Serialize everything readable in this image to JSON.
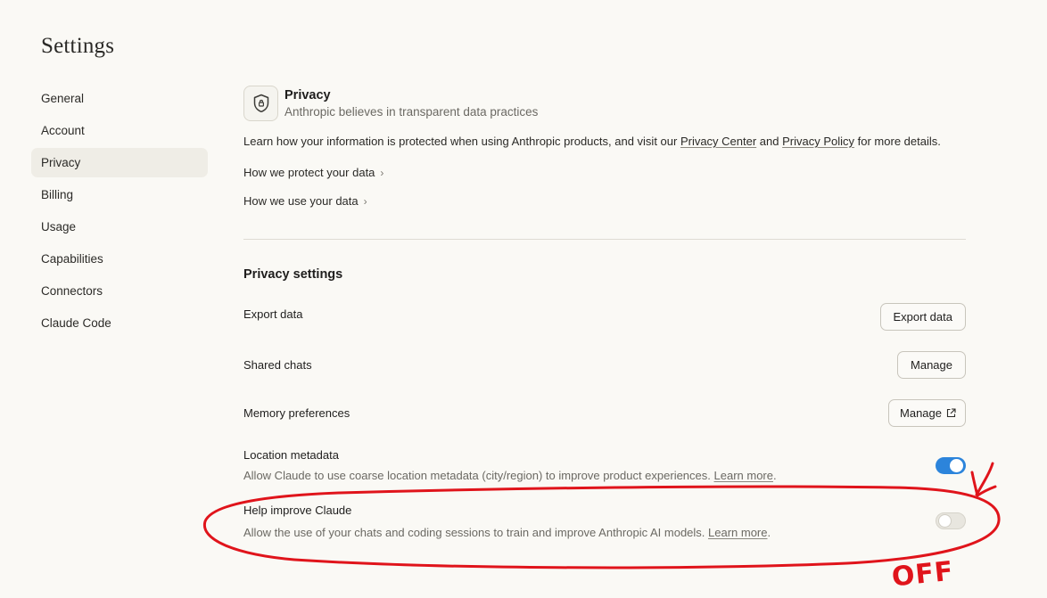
{
  "app": {
    "title": "Settings"
  },
  "sidebar": {
    "items": [
      {
        "label": "General",
        "active": false
      },
      {
        "label": "Account",
        "active": false
      },
      {
        "label": "Privacy",
        "active": true
      },
      {
        "label": "Billing",
        "active": false
      },
      {
        "label": "Usage",
        "active": false
      },
      {
        "label": "Capabilities",
        "active": false
      },
      {
        "label": "Connectors",
        "active": false
      },
      {
        "label": "Claude Code",
        "active": false
      }
    ]
  },
  "privacy": {
    "icon": "shield-lock-icon",
    "title": "Privacy",
    "subtitle": "Anthropic believes in transparent data practices",
    "intro_prefix": "Learn how your information is protected when using Anthropic products, and visit our ",
    "privacy_center_link": "Privacy Center",
    "intro_and": " and ",
    "privacy_policy_link": "Privacy Policy",
    "intro_suffix": " for more details.",
    "protect_link": "How we protect your data",
    "use_link": "How we use your data"
  },
  "privacy_settings": {
    "title": "Privacy settings",
    "export": {
      "label": "Export data",
      "button": "Export data"
    },
    "shared_chats": {
      "label": "Shared chats",
      "button": "Manage"
    },
    "memory": {
      "label": "Memory preferences",
      "button": "Manage",
      "button_icon": "external-link-icon"
    },
    "location": {
      "label": "Location metadata",
      "description": "Allow Claude to use coarse location metadata (city/region) to improve product experiences. ",
      "learn_more": "Learn more",
      "period": ".",
      "enabled": true
    },
    "help_improve": {
      "label": "Help improve Claude",
      "description": "Allow the use of your chats and coding sessions to train and improve Anthropic AI models. ",
      "learn_more": "Learn more",
      "period": ".",
      "enabled": false
    }
  },
  "annotation": {
    "text": "OFF",
    "color": "#e0141b"
  },
  "colors": {
    "toggle_on": "#2c84db",
    "background": "#faf9f5",
    "active_nav": "#efede6"
  }
}
